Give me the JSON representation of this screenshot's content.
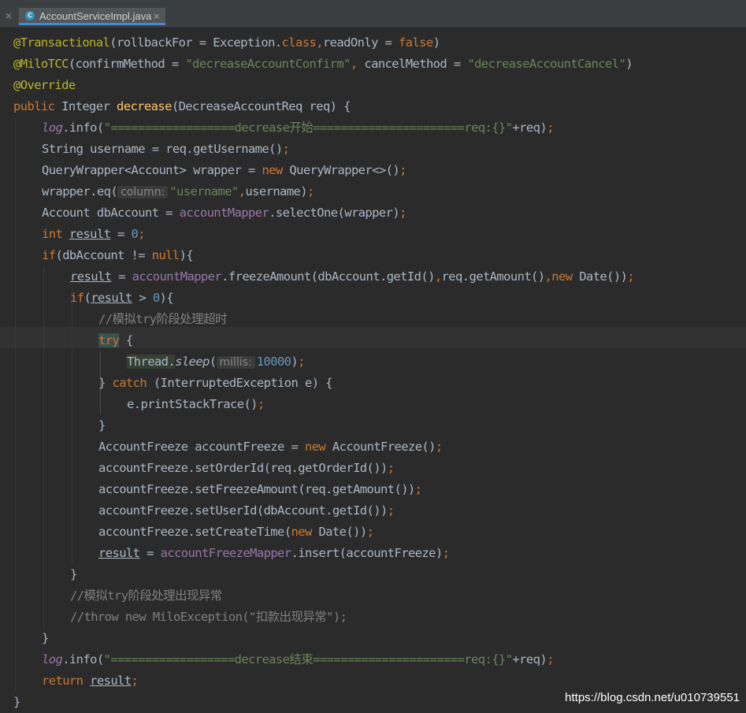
{
  "tab": {
    "label": "AccountServiceImpl.java",
    "icon": "C"
  },
  "tabbar": {
    "close_glyph": "×",
    "tab_close_glyph": "×"
  },
  "colors": {
    "background": "#2b2b2b",
    "keyword": "#cc7832",
    "annotation": "#bbb529",
    "string": "#6a8759",
    "number": "#6897bb",
    "field": "#9876aa",
    "method_decl": "#ffc66d",
    "comment": "#808080",
    "text": "#a9b7c6",
    "tab_accent": "#4a88c7"
  },
  "code": {
    "lines": [
      {
        "indent": 0,
        "tokens": [
          {
            "t": "@Transactional",
            "k": "ann"
          },
          {
            "t": "(rollbackFor = Exception.",
            "k": "plain"
          },
          {
            "t": "class",
            "k": "kw"
          },
          {
            "t": ",",
            "k": "kw"
          },
          {
            "t": "readOnly = ",
            "k": "plain"
          },
          {
            "t": "false",
            "k": "kw"
          },
          {
            "t": ")",
            "k": "plain"
          }
        ]
      },
      {
        "indent": 0,
        "tokens": [
          {
            "t": "@MiloTCC",
            "k": "ann"
          },
          {
            "t": "(confirmMethod = ",
            "k": "plain"
          },
          {
            "t": "\"decreaseAccountConfirm\"",
            "k": "str"
          },
          {
            "t": ", ",
            "k": "kw"
          },
          {
            "t": "cancelMethod = ",
            "k": "plain"
          },
          {
            "t": "\"decreaseAccountCancel\"",
            "k": "str"
          },
          {
            "t": ")",
            "k": "plain"
          }
        ]
      },
      {
        "indent": 0,
        "tokens": [
          {
            "t": "@Override",
            "k": "ann"
          }
        ]
      },
      {
        "indent": 0,
        "tokens": [
          {
            "t": "public ",
            "k": "kw"
          },
          {
            "t": "Integer ",
            "k": "plain"
          },
          {
            "t": "decrease",
            "k": "method"
          },
          {
            "t": "(DecreaseAccountReq req) {",
            "k": "plain"
          }
        ]
      },
      {
        "indent": 1,
        "tokens": [
          {
            "t": "log",
            "k": "static-fld"
          },
          {
            "t": ".info(",
            "k": "plain"
          },
          {
            "t": "\"==================decrease开始======================req:{}\"",
            "k": "str"
          },
          {
            "t": "+req)",
            "k": "plain"
          },
          {
            "t": ";",
            "k": "kw"
          }
        ]
      },
      {
        "indent": 1,
        "tokens": [
          {
            "t": "String username = req.getUsername()",
            "k": "plain"
          },
          {
            "t": ";",
            "k": "kw"
          }
        ]
      },
      {
        "indent": 1,
        "tokens": [
          {
            "t": "QueryWrapper<Account> wrapper = ",
            "k": "plain"
          },
          {
            "t": "new ",
            "k": "kw"
          },
          {
            "t": "QueryWrapper<>()",
            "k": "plain"
          },
          {
            "t": ";",
            "k": "kw"
          }
        ]
      },
      {
        "indent": 1,
        "tokens": [
          {
            "t": "wrapper.eq(",
            "k": "plain"
          },
          {
            "t": "column:",
            "k": "hint"
          },
          {
            "t": "\"username\"",
            "k": "str"
          },
          {
            "t": ",",
            "k": "kw"
          },
          {
            "t": "username)",
            "k": "plain"
          },
          {
            "t": ";",
            "k": "kw"
          }
        ]
      },
      {
        "indent": 1,
        "tokens": [
          {
            "t": "Account dbAccount = ",
            "k": "plain"
          },
          {
            "t": "accountMapper",
            "k": "fld"
          },
          {
            "t": ".selectOne(wrapper)",
            "k": "plain"
          },
          {
            "t": ";",
            "k": "kw"
          }
        ]
      },
      {
        "indent": 1,
        "tokens": [
          {
            "t": "int ",
            "k": "kw"
          },
          {
            "t": "result",
            "k": "ul"
          },
          {
            "t": " = ",
            "k": "plain"
          },
          {
            "t": "0",
            "k": "num"
          },
          {
            "t": ";",
            "k": "kw"
          }
        ]
      },
      {
        "indent": 1,
        "tokens": [
          {
            "t": "if",
            "k": "kw"
          },
          {
            "t": "(dbAccount != ",
            "k": "plain"
          },
          {
            "t": "null",
            "k": "kw"
          },
          {
            "t": "){",
            "k": "plain"
          }
        ]
      },
      {
        "indent": 2,
        "tokens": [
          {
            "t": "result",
            "k": "ul"
          },
          {
            "t": " = ",
            "k": "plain"
          },
          {
            "t": "accountMapper",
            "k": "fld"
          },
          {
            "t": ".freezeAmount(dbAccount.getId()",
            "k": "plain"
          },
          {
            "t": ",",
            "k": "kw"
          },
          {
            "t": "req.getAmount()",
            "k": "plain"
          },
          {
            "t": ",",
            "k": "kw"
          },
          {
            "t": "new ",
            "k": "kw"
          },
          {
            "t": "Date())",
            "k": "plain"
          },
          {
            "t": ";",
            "k": "kw"
          }
        ]
      },
      {
        "indent": 2,
        "tokens": [
          {
            "t": "if",
            "k": "kw"
          },
          {
            "t": "(",
            "k": "plain"
          },
          {
            "t": "result",
            "k": "ul"
          },
          {
            "t": " > ",
            "k": "plain"
          },
          {
            "t": "0",
            "k": "num"
          },
          {
            "t": "){",
            "k": "plain"
          }
        ]
      },
      {
        "indent": 3,
        "tokens": [
          {
            "t": "//模拟try阶段处理超时",
            "k": "cmt"
          }
        ]
      },
      {
        "indent": 3,
        "tokens": [
          {
            "t": "try",
            "k": "match"
          },
          {
            "t": " {",
            "k": "plain"
          }
        ]
      },
      {
        "indent": 4,
        "tokens": [
          {
            "t": "Thread.",
            "k": "usage"
          },
          {
            "t": "sleep",
            "k": "static"
          },
          {
            "t": "(",
            "k": "plain"
          },
          {
            "t": "millis:",
            "k": "hint"
          },
          {
            "t": "10000",
            "k": "num"
          },
          {
            "t": ")",
            "k": "plain"
          },
          {
            "t": ";",
            "k": "kw"
          }
        ]
      },
      {
        "indent": 3,
        "tokens": [
          {
            "t": "} ",
            "k": "plain"
          },
          {
            "t": "catch ",
            "k": "kw"
          },
          {
            "t": "(InterruptedException e) {",
            "k": "plain"
          }
        ]
      },
      {
        "indent": 4,
        "tokens": [
          {
            "t": "e.printStackTrace()",
            "k": "plain"
          },
          {
            "t": ";",
            "k": "kw"
          }
        ]
      },
      {
        "indent": 3,
        "tokens": [
          {
            "t": "}",
            "k": "plain"
          }
        ]
      },
      {
        "indent": 3,
        "tokens": [
          {
            "t": "AccountFreeze accountFreeze = ",
            "k": "plain"
          },
          {
            "t": "new ",
            "k": "kw"
          },
          {
            "t": "AccountFreeze()",
            "k": "plain"
          },
          {
            "t": ";",
            "k": "kw"
          }
        ]
      },
      {
        "indent": 3,
        "tokens": [
          {
            "t": "accountFreeze.setOrderId(req.getOrderId())",
            "k": "plain"
          },
          {
            "t": ";",
            "k": "kw"
          }
        ]
      },
      {
        "indent": 3,
        "tokens": [
          {
            "t": "accountFreeze.setFreezeAmount(req.getAmount())",
            "k": "plain"
          },
          {
            "t": ";",
            "k": "kw"
          }
        ]
      },
      {
        "indent": 3,
        "tokens": [
          {
            "t": "accountFreeze.setUserId(dbAccount.getId())",
            "k": "plain"
          },
          {
            "t": ";",
            "k": "kw"
          }
        ]
      },
      {
        "indent": 3,
        "tokens": [
          {
            "t": "accountFreeze.setCreateTime(",
            "k": "plain"
          },
          {
            "t": "new ",
            "k": "kw"
          },
          {
            "t": "Date())",
            "k": "plain"
          },
          {
            "t": ";",
            "k": "kw"
          }
        ]
      },
      {
        "indent": 3,
        "tokens": [
          {
            "t": "result",
            "k": "ul"
          },
          {
            "t": " = ",
            "k": "plain"
          },
          {
            "t": "accountFreezeMapper",
            "k": "fld"
          },
          {
            "t": ".insert(accountFreeze)",
            "k": "plain"
          },
          {
            "t": ";",
            "k": "kw"
          }
        ]
      },
      {
        "indent": 2,
        "tokens": [
          {
            "t": "}",
            "k": "plain"
          }
        ]
      },
      {
        "indent": 2,
        "tokens": [
          {
            "t": "//模拟try阶段处理出现异常",
            "k": "cmt"
          }
        ]
      },
      {
        "indent": 2,
        "tokens": [
          {
            "t": "//throw new MiloException(\"扣款出现异常\");",
            "k": "cmt"
          }
        ]
      },
      {
        "indent": 1,
        "tokens": [
          {
            "t": "}",
            "k": "plain"
          }
        ]
      },
      {
        "indent": 1,
        "tokens": [
          {
            "t": "log",
            "k": "static-fld"
          },
          {
            "t": ".info(",
            "k": "plain"
          },
          {
            "t": "\"==================decrease结束======================req:{}\"",
            "k": "str"
          },
          {
            "t": "+req)",
            "k": "plain"
          },
          {
            "t": ";",
            "k": "kw"
          }
        ]
      },
      {
        "indent": 1,
        "tokens": [
          {
            "t": "return ",
            "k": "kw"
          },
          {
            "t": "result",
            "k": "ul"
          },
          {
            "t": ";",
            "k": "kw"
          }
        ]
      },
      {
        "indent": 0,
        "tokens": [
          {
            "t": "}",
            "k": "plain"
          }
        ]
      }
    ]
  },
  "watermark": "https://blog.csdn.net/u010739551"
}
